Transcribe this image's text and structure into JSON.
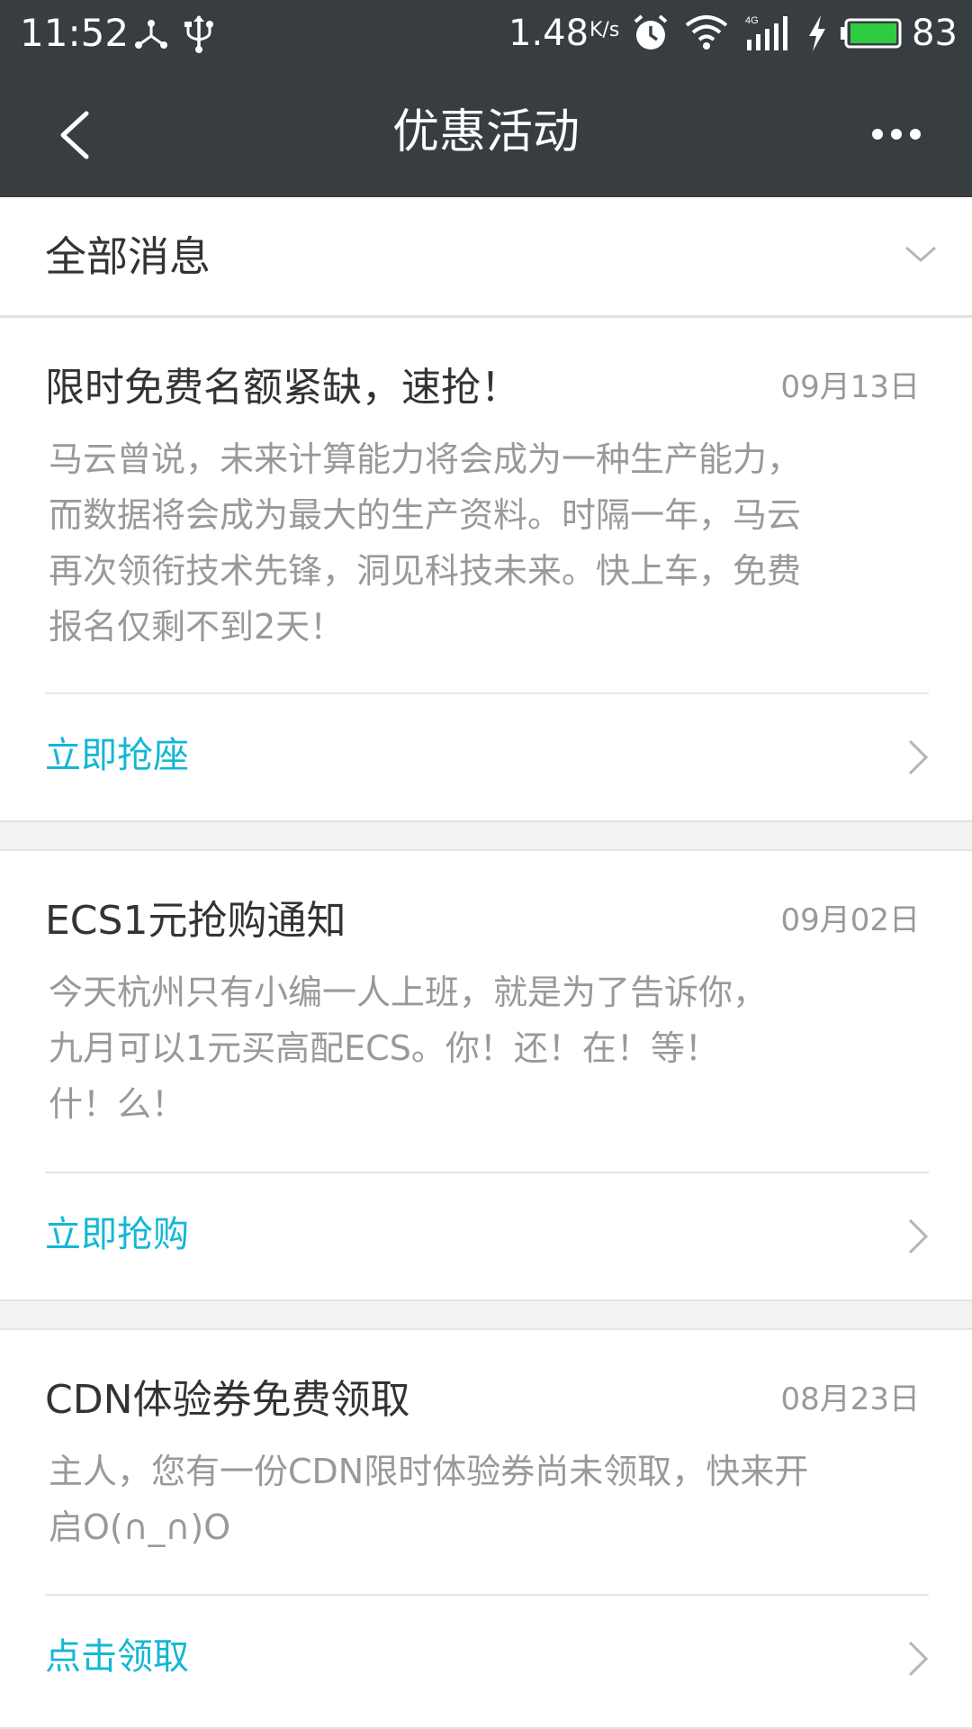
{
  "status_bar": {
    "time": "11:52",
    "speed": "1.48",
    "speed_unit": "K/s",
    "battery": "83",
    "icons": [
      "network-share-icon",
      "usb-icon",
      "alarm-icon",
      "wifi-icon",
      "signal-4g-icon",
      "charging-icon",
      "battery-icon"
    ],
    "battery_color": "#2ecc40"
  },
  "nav": {
    "title": "优惠活动",
    "back_icon": "chevron-left-icon",
    "more_icon": "more-dots-icon"
  },
  "filter": {
    "label": "全部消息",
    "icon": "chevron-down-icon"
  },
  "messages": [
    {
      "title": "限时免费名额紧缺，速抢！",
      "date": "09月13日",
      "desc": "马云曾说，未来计算能力将会成为一种生产能力，而数据将会成为最大的生产资料。时隔一年，马云再次领衔技术先锋，洞见科技未来。快上车，免费报名仅剩不到2天！",
      "action": "立即抢座"
    },
    {
      "title": "ECS1元抢购通知",
      "date": "09月02日",
      "desc": "今天杭州只有小编一人上班，就是为了告诉你，九月可以1元买高配ECS。你！还！在！等！什！么！",
      "action": "立即抢购"
    },
    {
      "title": "CDN体验券免费领取",
      "date": "08月23日",
      "desc": "主人，您有一份CDN限时体验券尚未领取，快来开启O(∩_∩)O",
      "action": "点击领取"
    }
  ],
  "colors": {
    "header_bg": "#383d42",
    "accent": "#12b7d4",
    "page_bg": "#f2f2f2"
  }
}
